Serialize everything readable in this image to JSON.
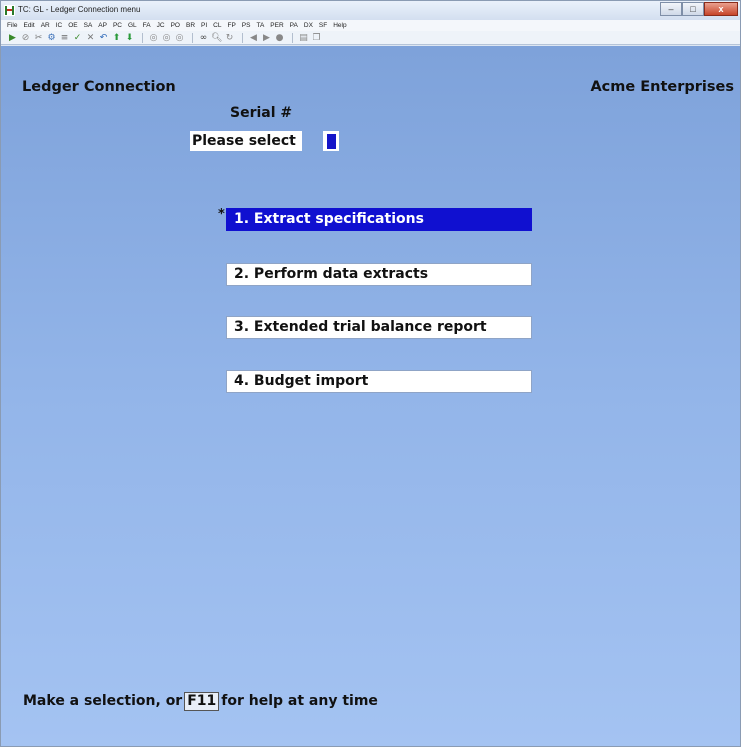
{
  "window": {
    "title": "TC: GL - Ledger Connection menu",
    "buttons": [
      "–",
      "□",
      "x"
    ]
  },
  "menubar": [
    "File",
    "Edit",
    "AR",
    "IC",
    "OE",
    "SA",
    "AP",
    "PC",
    "GL",
    "FA",
    "JC",
    "PO",
    "BR",
    "PI",
    "CL",
    "FP",
    "PS",
    "TA",
    "PER",
    "PA",
    "DX",
    "SF",
    "Help"
  ],
  "toolbar": {
    "icons": [
      "start-icon",
      "cancel-icon",
      "cut-icon",
      "settings-icon",
      "list-icon",
      "check-icon",
      "delete-icon",
      "undo-icon",
      "up-arrow-icon",
      "down-arrow-icon",
      "circle-icon-1",
      "circle-icon-2",
      "circle-icon-3",
      "binoculars-icon",
      "zoom-icon",
      "refresh-icon",
      "prev-icon",
      "next-icon",
      "user-icon",
      "page-icon",
      "copy-icon"
    ]
  },
  "header": {
    "left": "Ledger Connection",
    "right": "Acme Enterprises"
  },
  "form": {
    "serial_label": "Serial #",
    "please_select": "Please select",
    "selected_marker": "*"
  },
  "menu": {
    "items": [
      "1. Extract specifications",
      "2. Perform data extracts",
      "3. Extended trial balance report",
      "4. Budget import"
    ],
    "selected_index": 0
  },
  "status": {
    "prefix": "Make a selection, or",
    "key": "F11",
    "suffix": "for help at any time"
  },
  "colors": {
    "background_top": "#7ea2da",
    "background_bottom": "#a4c3f2",
    "selection": "#1010d0",
    "cursor": "#1414c8"
  }
}
